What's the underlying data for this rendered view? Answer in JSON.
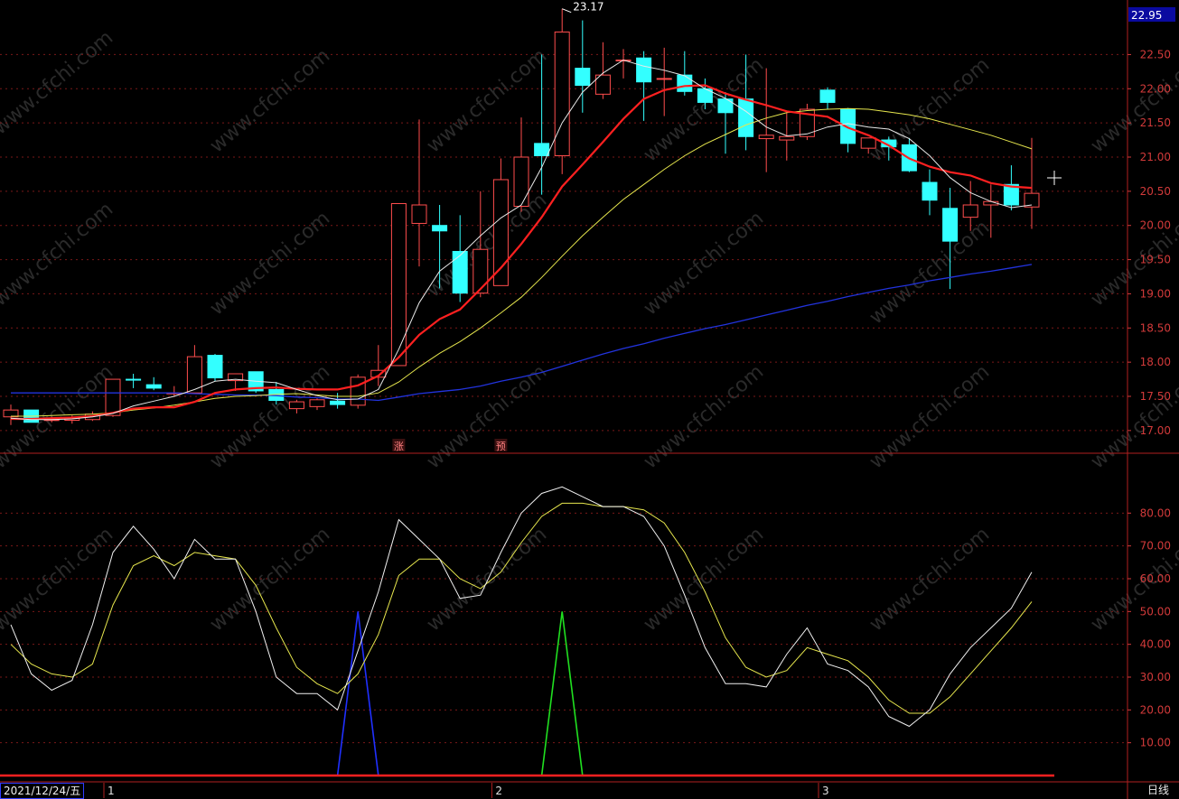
{
  "chart_data": [
    {
      "type": "candlestick",
      "title": "",
      "price_label_top": "22.95",
      "high_annotation": "23.17",
      "ylim": [
        16.8,
        23.1
      ],
      "yticks": [
        "22.50",
        "22.00",
        "21.50",
        "21.00",
        "20.50",
        "20.00",
        "19.50",
        "19.00",
        "18.50",
        "18.00",
        "17.50",
        "17.00"
      ],
      "candles": [
        {
          "o": 17.2,
          "h": 17.38,
          "l": 17.08,
          "c": 17.3
        },
        {
          "o": 17.3,
          "h": 17.3,
          "l": 17.12,
          "c": 17.12
        },
        {
          "o": 17.15,
          "h": 17.2,
          "l": 17.12,
          "c": 17.16
        },
        {
          "o": 17.15,
          "h": 17.22,
          "l": 17.1,
          "c": 17.18
        },
        {
          "o": 17.16,
          "h": 17.28,
          "l": 17.14,
          "c": 17.24
        },
        {
          "o": 17.22,
          "h": 17.75,
          "l": 17.2,
          "c": 17.75
        },
        {
          "o": 17.75,
          "h": 17.83,
          "l": 17.62,
          "c": 17.74
        },
        {
          "o": 17.67,
          "h": 17.78,
          "l": 17.59,
          "c": 17.62
        },
        {
          "o": 17.55,
          "h": 17.65,
          "l": 17.5,
          "c": 17.55
        },
        {
          "o": 17.55,
          "h": 18.25,
          "l": 17.55,
          "c": 18.08
        },
        {
          "o": 18.1,
          "h": 18.12,
          "l": 17.72,
          "c": 17.77
        },
        {
          "o": 17.73,
          "h": 17.83,
          "l": 17.58,
          "c": 17.83
        },
        {
          "o": 17.86,
          "h": 17.86,
          "l": 17.55,
          "c": 17.58
        },
        {
          "o": 17.6,
          "h": 17.71,
          "l": 17.38,
          "c": 17.44
        },
        {
          "o": 17.32,
          "h": 17.45,
          "l": 17.25,
          "c": 17.42
        },
        {
          "o": 17.35,
          "h": 17.47,
          "l": 17.3,
          "c": 17.45
        },
        {
          "o": 17.43,
          "h": 17.55,
          "l": 17.32,
          "c": 17.38
        },
        {
          "o": 17.37,
          "h": 17.82,
          "l": 17.32,
          "c": 17.78
        },
        {
          "o": 17.78,
          "h": 18.25,
          "l": 17.65,
          "c": 17.88
        },
        {
          "o": 17.95,
          "h": 20.32,
          "l": 17.95,
          "c": 20.32
        },
        {
          "o": 20.03,
          "h": 21.55,
          "l": 19.4,
          "c": 20.3
        },
        {
          "o": 20.0,
          "h": 20.3,
          "l": 19.08,
          "c": 19.92
        },
        {
          "o": 19.62,
          "h": 20.15,
          "l": 18.88,
          "c": 19.01
        },
        {
          "o": 19.01,
          "h": 20.5,
          "l": 18.95,
          "c": 19.65
        },
        {
          "o": 19.12,
          "h": 20.98,
          "l": 19.12,
          "c": 20.67
        },
        {
          "o": 20.28,
          "h": 21.58,
          "l": 20.2,
          "c": 21.0
        },
        {
          "o": 21.2,
          "h": 22.5,
          "l": 20.45,
          "c": 21.02
        },
        {
          "o": 21.02,
          "h": 23.17,
          "l": 20.75,
          "c": 22.83
        },
        {
          "o": 22.3,
          "h": 23.0,
          "l": 21.65,
          "c": 22.05
        },
        {
          "o": 21.92,
          "h": 22.68,
          "l": 21.85,
          "c": 22.2
        },
        {
          "o": 22.42,
          "h": 22.58,
          "l": 22.15,
          "c": 22.42
        },
        {
          "o": 22.45,
          "h": 22.55,
          "l": 21.53,
          "c": 22.1
        },
        {
          "o": 22.15,
          "h": 22.6,
          "l": 21.6,
          "c": 22.15
        },
        {
          "o": 22.2,
          "h": 22.55,
          "l": 21.9,
          "c": 21.96
        },
        {
          "o": 22.0,
          "h": 22.15,
          "l": 21.7,
          "c": 21.8
        },
        {
          "o": 21.85,
          "h": 21.95,
          "l": 21.05,
          "c": 21.65
        },
        {
          "o": 21.85,
          "h": 22.5,
          "l": 21.1,
          "c": 21.3
        },
        {
          "o": 21.27,
          "h": 22.3,
          "l": 20.78,
          "c": 21.32
        },
        {
          "o": 21.25,
          "h": 21.65,
          "l": 20.95,
          "c": 21.3
        },
        {
          "o": 21.3,
          "h": 21.78,
          "l": 21.25,
          "c": 21.7
        },
        {
          "o": 21.98,
          "h": 22.02,
          "l": 21.7,
          "c": 21.8
        },
        {
          "o": 21.7,
          "h": 21.72,
          "l": 21.07,
          "c": 21.2
        },
        {
          "o": 21.13,
          "h": 21.27,
          "l": 21.05,
          "c": 21.28
        },
        {
          "o": 21.25,
          "h": 21.3,
          "l": 20.95,
          "c": 21.15
        },
        {
          "o": 21.18,
          "h": 21.28,
          "l": 20.78,
          "c": 20.8
        },
        {
          "o": 20.63,
          "h": 20.82,
          "l": 20.15,
          "c": 20.37
        },
        {
          "o": 20.25,
          "h": 20.55,
          "l": 19.07,
          "c": 19.77
        },
        {
          "o": 20.12,
          "h": 20.65,
          "l": 19.92,
          "c": 20.3
        },
        {
          "o": 20.3,
          "h": 20.6,
          "l": 19.82,
          "c": 20.35
        },
        {
          "o": 20.6,
          "h": 20.88,
          "l": 20.22,
          "c": 20.3
        },
        {
          "o": 20.27,
          "h": 21.28,
          "l": 19.95,
          "c": 20.47
        }
      ],
      "ma_white": [
        17.18,
        17.16,
        17.16,
        17.17,
        17.2,
        17.25,
        17.36,
        17.43,
        17.5,
        17.6,
        17.72,
        17.75,
        17.72,
        17.7,
        17.6,
        17.51,
        17.45,
        17.46,
        17.6,
        18.19,
        18.87,
        19.33,
        19.56,
        19.85,
        20.11,
        20.3,
        20.85,
        21.5,
        21.95,
        22.23,
        22.42,
        22.33,
        22.27,
        22.19,
        22.0,
        21.86,
        21.67,
        21.44,
        21.31,
        21.34,
        21.44,
        21.49,
        21.44,
        21.41,
        21.27,
        21.02,
        20.7,
        20.48,
        20.35,
        20.26,
        20.3
      ],
      "ma_yellow": [
        17.21,
        17.21,
        17.22,
        17.23,
        17.24,
        17.26,
        17.3,
        17.33,
        17.37,
        17.42,
        17.47,
        17.5,
        17.51,
        17.53,
        17.54,
        17.52,
        17.5,
        17.5,
        17.55,
        17.71,
        17.93,
        18.13,
        18.3,
        18.5,
        18.72,
        18.95,
        19.24,
        19.55,
        19.85,
        20.12,
        20.38,
        20.6,
        20.82,
        21.02,
        21.19,
        21.33,
        21.47,
        21.57,
        21.65,
        21.68,
        21.7,
        21.71,
        21.7,
        21.66,
        21.62,
        21.56,
        21.48,
        21.4,
        21.32,
        21.22,
        21.12
      ],
      "ma_red": [
        17.17,
        17.17,
        17.18,
        17.19,
        17.21,
        17.26,
        17.32,
        17.34,
        17.34,
        17.42,
        17.55,
        17.6,
        17.62,
        17.63,
        17.61,
        17.6,
        17.6,
        17.66,
        17.8,
        18.07,
        18.4,
        18.63,
        18.77,
        19.07,
        19.38,
        19.73,
        20.12,
        20.57,
        20.89,
        21.22,
        21.56,
        21.85,
        21.98,
        22.04,
        22.05,
        21.93,
        21.84,
        21.76,
        21.67,
        21.63,
        21.59,
        21.43,
        21.32,
        21.17,
        20.98,
        20.86,
        20.78,
        20.73,
        20.62,
        20.57,
        20.55
      ],
      "ma_blue": [
        17.55,
        17.55,
        17.55,
        17.55,
        17.55,
        17.55,
        17.55,
        17.55,
        17.55,
        17.54,
        17.53,
        17.52,
        17.52,
        17.51,
        17.49,
        17.48,
        17.46,
        17.46,
        17.44,
        17.49,
        17.54,
        17.57,
        17.6,
        17.65,
        17.72,
        17.78,
        17.85,
        17.94,
        18.03,
        18.12,
        18.2,
        18.27,
        18.35,
        18.42,
        18.49,
        18.55,
        18.62,
        18.69,
        18.76,
        18.83,
        18.89,
        18.96,
        19.02,
        19.08,
        19.13,
        19.19,
        19.24,
        19.29,
        19.33,
        19.38,
        19.43
      ],
      "markers": [
        {
          "index": 19,
          "label": "涨"
        },
        {
          "index": 24,
          "label": "预"
        }
      ]
    },
    {
      "type": "line",
      "title": "",
      "ylim": [
        0,
        90
      ],
      "yticks": [
        "80.00",
        "70.00",
        "60.00",
        "50.00",
        "40.00",
        "30.00",
        "20.00",
        "10.00"
      ],
      "series": [
        {
          "values": [
            46,
            31,
            26,
            29,
            46,
            68,
            76,
            69,
            60,
            72,
            66,
            66,
            50,
            30,
            25,
            25,
            20,
            38,
            56,
            78,
            72,
            66,
            54,
            55,
            68,
            80,
            86,
            88,
            85,
            82,
            82,
            79,
            70,
            55,
            39,
            28,
            28,
            27,
            37,
            45,
            34,
            32,
            27,
            18,
            15,
            20,
            31,
            39,
            45,
            51,
            62
          ]
        },
        {
          "values": [
            40,
            34,
            31,
            30,
            34,
            52,
            64,
            67,
            64,
            68,
            67,
            66,
            58,
            45,
            33,
            28,
            25,
            31,
            43,
            61,
            66,
            66,
            60,
            57,
            62,
            71,
            79,
            83,
            83,
            82,
            82,
            81,
            77,
            68,
            56,
            42,
            33,
            30,
            32,
            39,
            37,
            35,
            30,
            23,
            19,
            19,
            24,
            31,
            38,
            45,
            53
          ]
        }
      ],
      "spikes": [
        {
          "center": 17,
          "value": 50,
          "color": "blue"
        },
        {
          "center": 27,
          "value": 50,
          "color": "green"
        }
      ]
    }
  ],
  "footer": {
    "date_label": "2021/12/24/五",
    "month_labels": [
      {
        "index": 5,
        "label": "1"
      },
      {
        "index": 24,
        "label": "2"
      },
      {
        "index": 40,
        "label": "3"
      }
    ],
    "period_label": "日线"
  },
  "watermark": "www.cfchi.com",
  "colors": {
    "background": "#000000",
    "up_candle": "#ff4d4d",
    "down_candle": "#33ffff",
    "ma_white": "#e8e8e8",
    "ma_yellow": "#e6e64d",
    "ma_red": "#ff2020",
    "ma_blue": "#2233dd",
    "grid": "#7a1818",
    "axis_text": "#d23a3a"
  }
}
